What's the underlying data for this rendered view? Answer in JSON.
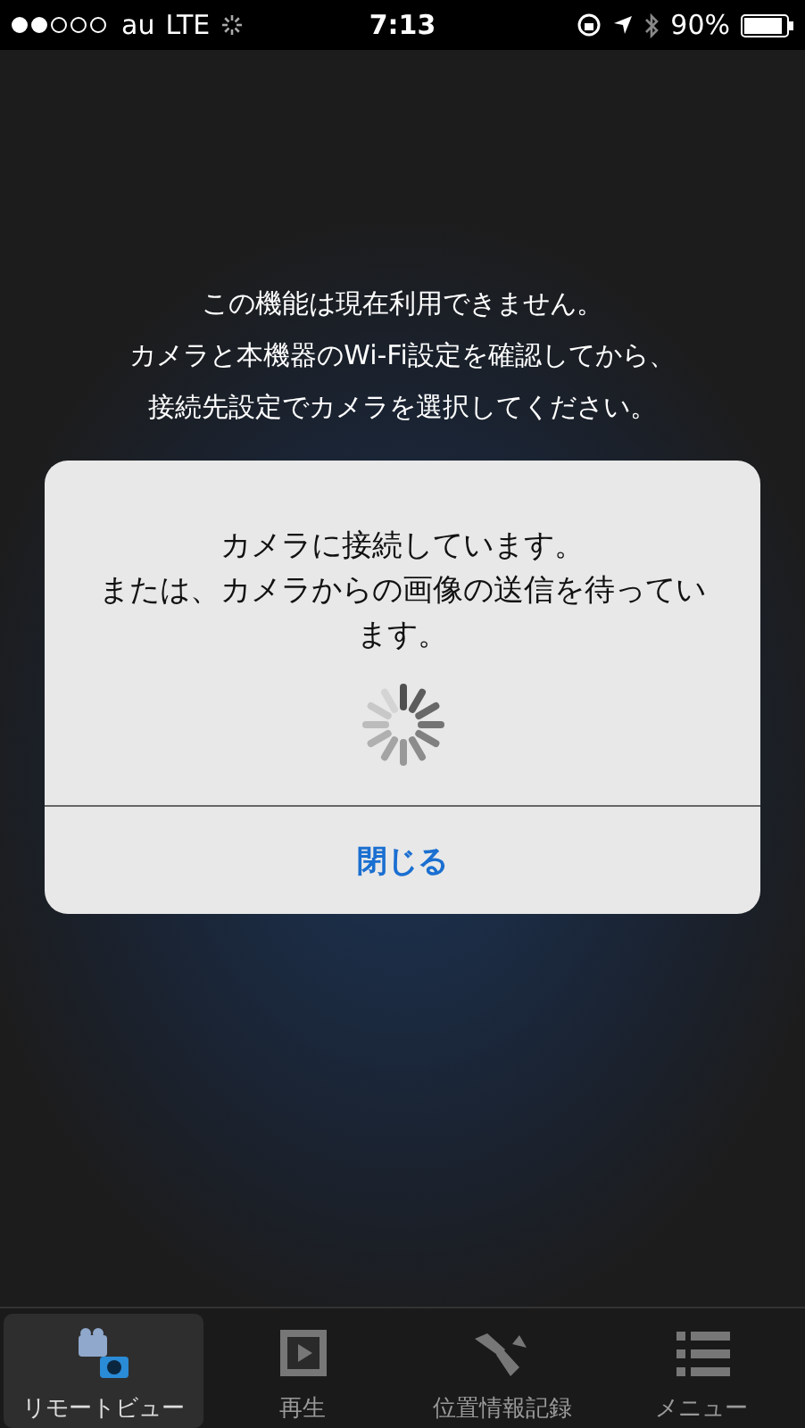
{
  "status_bar": {
    "carrier": "au",
    "network": "LTE",
    "time": "7:13",
    "battery": "90%"
  },
  "notice": [
    "この機能は現在利用できません。",
    "カメラと本機器のWi-Fi設定を確認してから、",
    "接続先設定でカメラを選択してください。"
  ],
  "dialog": {
    "message": [
      "カメラに接続しています。",
      "または、カメラからの画像の送信を待っています。"
    ],
    "button": "閉じる"
  },
  "tabs": [
    {
      "label": "リモートビュー",
      "kind": "remote",
      "selected": true
    },
    {
      "label": "再生",
      "kind": "play",
      "selected": false
    },
    {
      "label": "位置情報記録",
      "kind": "location",
      "selected": false
    },
    {
      "label": "メニュー",
      "kind": "menu",
      "selected": false
    }
  ]
}
